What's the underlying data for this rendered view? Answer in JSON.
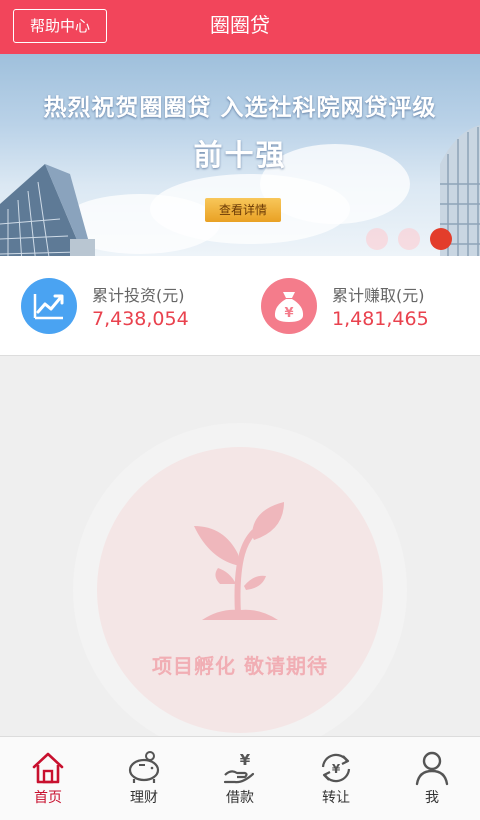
{
  "header": {
    "help_label": "帮助中心",
    "title": "圈圈贷"
  },
  "banner": {
    "headline": "热烈祝贺圈圈贷 入选社科院网贷评级",
    "subheadline": "前十强",
    "button_label": "查看详情",
    "active_dot": 3,
    "dot_count": 3
  },
  "stats": [
    {
      "label": "累计投资(元)",
      "value": "7,438,054",
      "icon": "trend-chart-icon"
    },
    {
      "label": "累计赚取(元)",
      "value": "1,481,465",
      "icon": "money-bag-icon"
    }
  ],
  "empty_state": {
    "icon": "sprout-icon",
    "text": "项目孵化  敬请期待"
  },
  "tabbar": {
    "active": "home",
    "items": [
      {
        "id": "home",
        "label": "首页",
        "icon": "home-icon"
      },
      {
        "id": "finance",
        "label": "理财",
        "icon": "piggy-bank-icon"
      },
      {
        "id": "borrow",
        "label": "借款",
        "icon": "hand-yuan-icon"
      },
      {
        "id": "transfer",
        "label": "转让",
        "icon": "transfer-icon"
      },
      {
        "id": "me",
        "label": "我",
        "icon": "user-icon"
      }
    ]
  },
  "colors": {
    "brand": "#f2455b",
    "value_red": "#e9424e",
    "stat_blue": "#4aa3f2",
    "stat_pink": "#f47c8b",
    "active_tab": "#c8102e"
  }
}
